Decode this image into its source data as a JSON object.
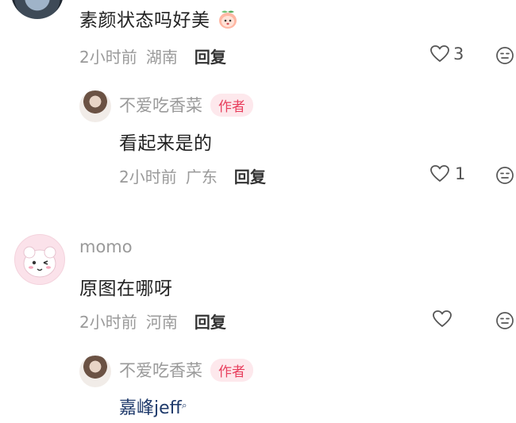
{
  "comments": [
    {
      "text": "素颜状态吗好美",
      "time": "2小时前",
      "location": "湖南",
      "reply_label": "回复",
      "likes": "3",
      "replies": [
        {
          "author": "不爱吃香菜",
          "badge": "作者",
          "text": "看起来是的",
          "time": "2小时前",
          "location": "广东",
          "reply_label": "回复",
          "likes": "1"
        }
      ]
    },
    {
      "author": "momo",
      "text": "原图在哪呀",
      "time": "2小时前",
      "location": "河南",
      "reply_label": "回复",
      "likes": "",
      "replies": [
        {
          "author": "不爱吃香菜",
          "badge": "作者",
          "mention": "嘉峰jeff"
        }
      ]
    }
  ],
  "icons": {
    "like": "heart-outline-icon",
    "emoji": "emoji-face-icon",
    "emoji_in_text": "peach-emoji-icon"
  },
  "colors": {
    "badge_text": "#e8405e",
    "badge_bg": "#fde8ec",
    "meta_text": "#9a9a9a",
    "mention_text": "#1f3a6b"
  }
}
